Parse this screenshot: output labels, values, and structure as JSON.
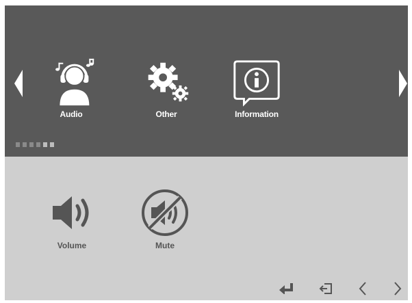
{
  "top_menu": {
    "items": [
      {
        "label": "Audio",
        "icon": "headphones-person-icon"
      },
      {
        "label": "Other",
        "icon": "gears-icon"
      },
      {
        "label": "Information",
        "icon": "info-bubble-icon"
      }
    ],
    "page_indicator": {
      "total": 6,
      "active": [
        5,
        6
      ]
    }
  },
  "sub_menu": {
    "items": [
      {
        "label": "Volume",
        "icon": "speaker-icon"
      },
      {
        "label": "Mute",
        "icon": "mute-icon"
      }
    ]
  },
  "bottom_nav": {
    "buttons": [
      {
        "icon": "enter-icon"
      },
      {
        "icon": "exit-icon"
      },
      {
        "icon": "left-chevron-icon"
      },
      {
        "icon": "right-chevron-icon"
      }
    ]
  },
  "colors": {
    "top_panel": "#595959",
    "bottom_panel": "#cfcfcf",
    "label_light": "#ffffff",
    "label_dark": "#555555",
    "icon_dark": "#555555"
  }
}
